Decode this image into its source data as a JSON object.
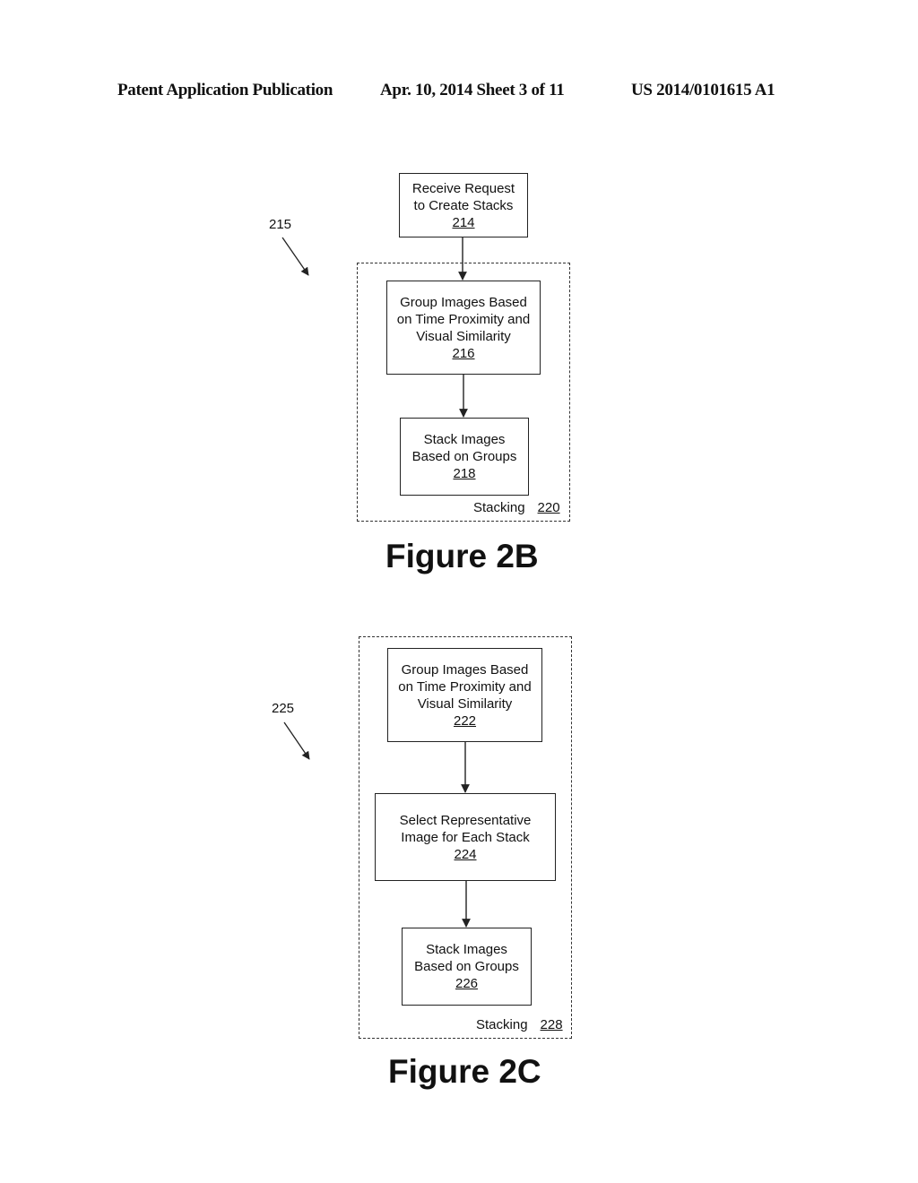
{
  "header": {
    "left": "Patent Application Publication",
    "middle": "Apr. 10, 2014  Sheet 3 of 11",
    "right": "US 2014/0101615 A1"
  },
  "figure_2b": {
    "ref_label": "215",
    "boxes": [
      {
        "lines": [
          "Receive Request",
          "to Create Stacks"
        ],
        "ref": "214"
      },
      {
        "lines": [
          "Group Images Based",
          "on Time Proximity and",
          "Visual Similarity"
        ],
        "ref": "216"
      },
      {
        "lines": [
          "Stack Images",
          "Based on Groups"
        ],
        "ref": "218"
      }
    ],
    "container": {
      "label": "Stacking",
      "ref": "220"
    },
    "caption": "Figure 2B"
  },
  "figure_2c": {
    "ref_label": "225",
    "boxes": [
      {
        "lines": [
          "Group Images Based",
          "on Time Proximity and",
          "Visual Similarity"
        ],
        "ref": "222"
      },
      {
        "lines": [
          "Select Representative",
          "Image for Each Stack"
        ],
        "ref": "224"
      },
      {
        "lines": [
          "Stack Images",
          "Based on Groups"
        ],
        "ref": "226"
      }
    ],
    "container": {
      "label": "Stacking",
      "ref": "228"
    },
    "caption": "Figure 2C"
  }
}
